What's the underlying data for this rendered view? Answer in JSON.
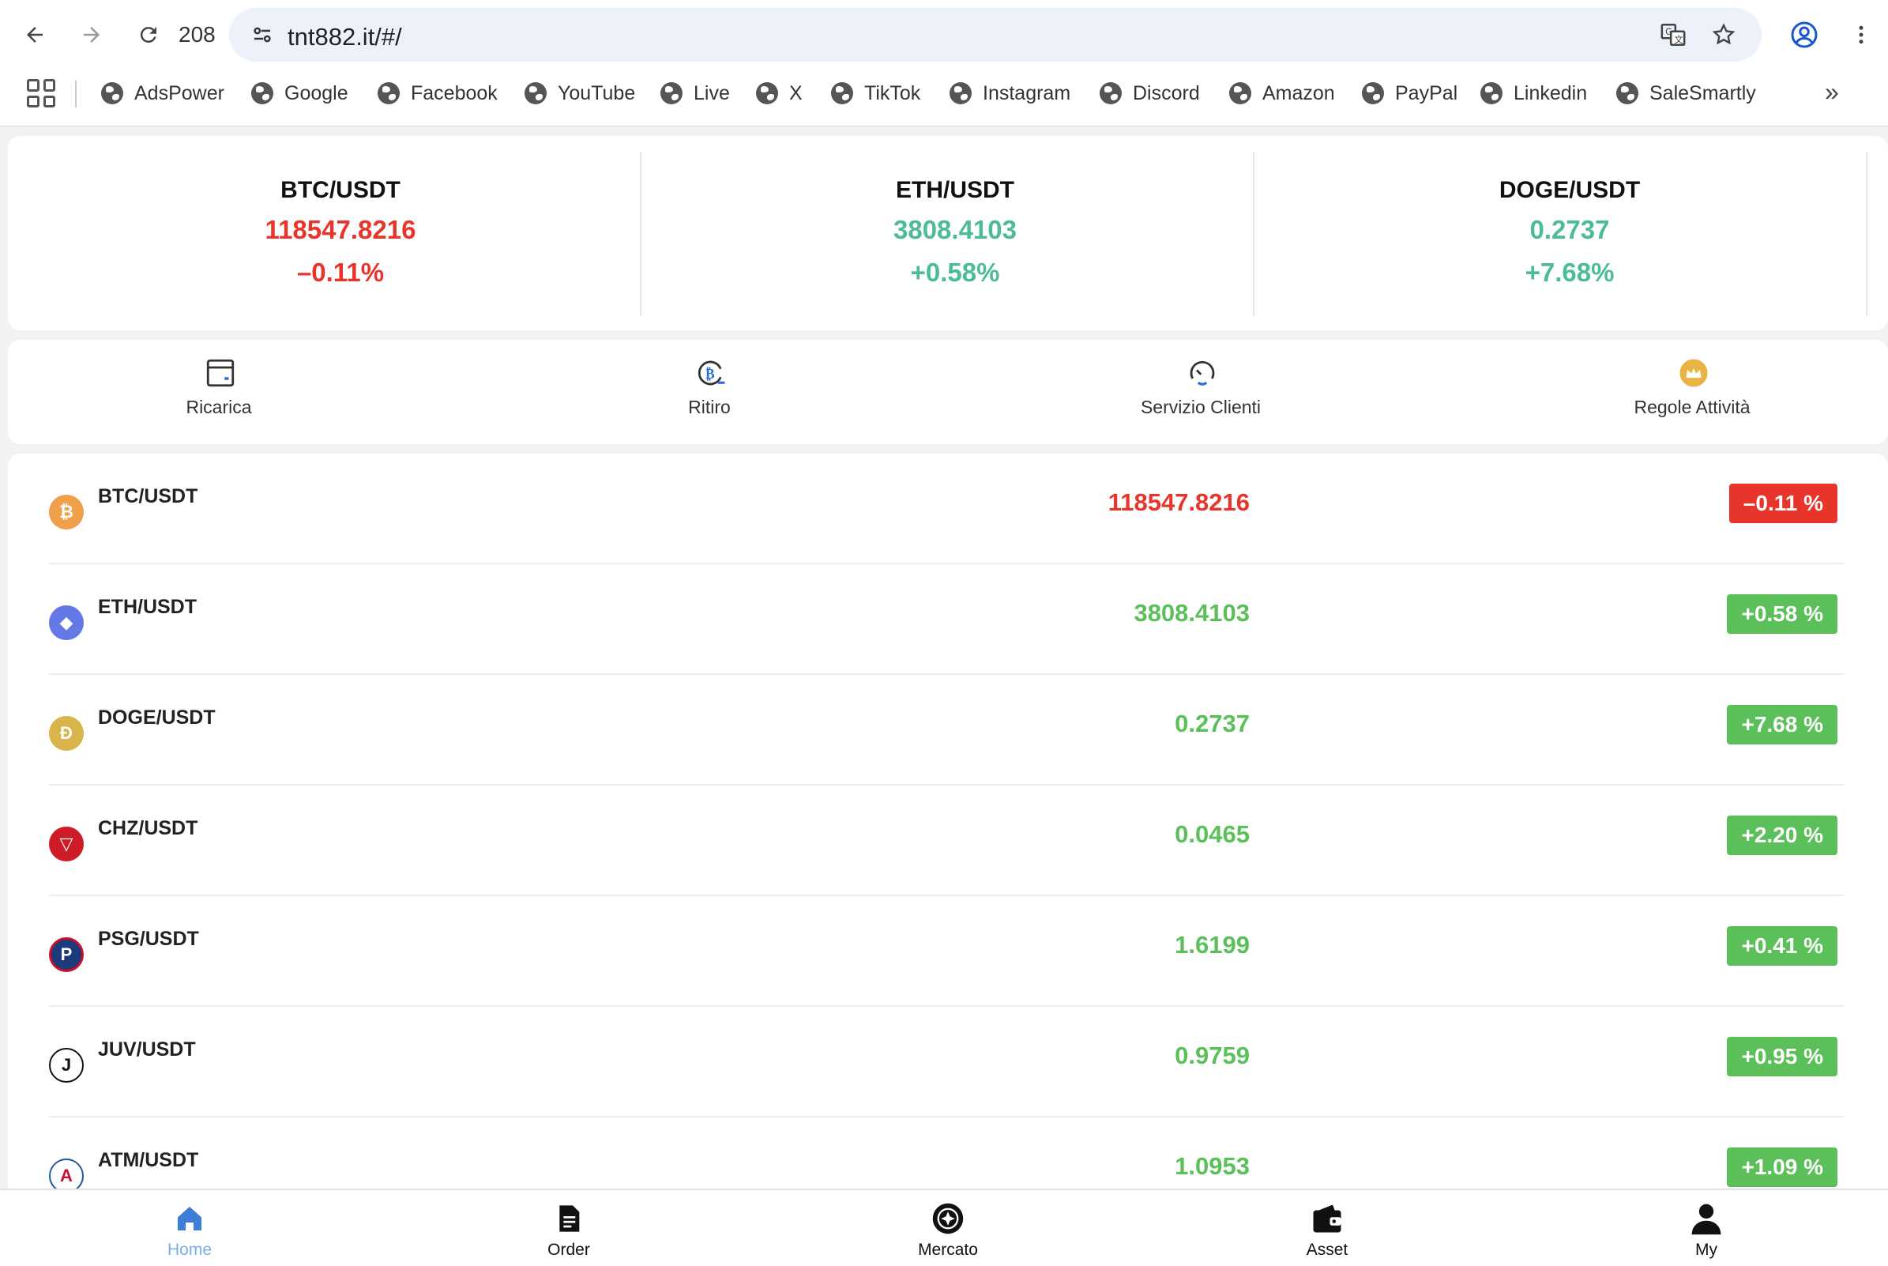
{
  "browser": {
    "reload_count": "208",
    "url": "tnt882.it/#/",
    "bookmarks": [
      "AdsPower",
      "Google",
      "Facebook",
      "YouTube",
      "Live",
      "X",
      "TikTok",
      "Instagram",
      "Discord",
      "Amazon",
      "PayPal",
      "Linkedin",
      "SaleSmartly"
    ],
    "more": "»"
  },
  "tickers": [
    {
      "symbol": "BTC/USDT",
      "price": "118547.8216",
      "change": "–0.11%",
      "trend": "down"
    },
    {
      "symbol": "ETH/USDT",
      "price": "3808.4103",
      "change": "+0.58%",
      "trend": "up"
    },
    {
      "symbol": "DOGE/USDT",
      "price": "0.2737",
      "change": "+7.68%",
      "trend": "up"
    }
  ],
  "actions": [
    {
      "label": "Ricarica",
      "icon": "wallet-card-icon"
    },
    {
      "label": "Ritiro",
      "icon": "bitcoin-withdraw-icon"
    },
    {
      "label": "Servizio Clienti",
      "icon": "customer-service-icon"
    },
    {
      "label": "Regole Attività",
      "icon": "crown-icon"
    }
  ],
  "markets": [
    {
      "symbol": "BTC/USDT",
      "price": "118547.8216",
      "change": "–0.11 %",
      "trend": "down",
      "icon_color": "#f0a04b",
      "glyph": "₿"
    },
    {
      "symbol": "ETH/USDT",
      "price": "3808.4103",
      "change": "+0.58 %",
      "trend": "up",
      "icon_color": "#6478e6",
      "glyph": "◆"
    },
    {
      "symbol": "DOGE/USDT",
      "price": "0.2737",
      "change": "+7.68 %",
      "trend": "up",
      "icon_color": "#d9b44a",
      "glyph": "Ð"
    },
    {
      "symbol": "CHZ/USDT",
      "price": "0.0465",
      "change": "+2.20 %",
      "trend": "up",
      "icon_color": "#cd1b27",
      "glyph": "▽"
    },
    {
      "symbol": "PSG/USDT",
      "price": "1.6199",
      "change": "+0.41 %",
      "trend": "up",
      "icon_color": "#1d3a7a",
      "glyph": "P"
    },
    {
      "symbol": "JUV/USDT",
      "price": "0.9759",
      "change": "+0.95 %",
      "trend": "up",
      "icon_color": "#ffffff",
      "glyph": "J"
    },
    {
      "symbol": "ATM/USDT",
      "price": "1.0953",
      "change": "+1.09 %",
      "trend": "up",
      "icon_color": "#ffffff",
      "glyph": "A"
    }
  ],
  "bottom_nav": [
    {
      "label": "Home",
      "active": true
    },
    {
      "label": "Order",
      "active": false
    },
    {
      "label": "Mercato",
      "active": false
    },
    {
      "label": "Asset",
      "active": false
    },
    {
      "label": "My",
      "active": false
    }
  ],
  "colors": {
    "down": "#e8352b",
    "up_ticker": "#4cbc93",
    "up_list": "#5cc05a",
    "active_tab": "#3d7fd8"
  }
}
